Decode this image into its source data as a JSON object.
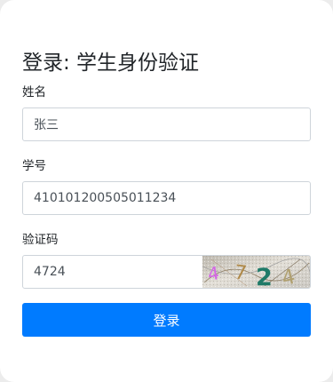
{
  "form": {
    "title": "登录: 学生身份验证",
    "name_label": "姓名",
    "name_value": "张三",
    "student_id_label": "学号",
    "student_id_value": "410101200505011234",
    "captcha_label": "验证码",
    "captcha_value": "4724",
    "captcha_image_text": "4724",
    "login_label": "登录"
  },
  "colors": {
    "primary": "#007bff",
    "text": "#212529",
    "input_border": "#ced4da"
  }
}
